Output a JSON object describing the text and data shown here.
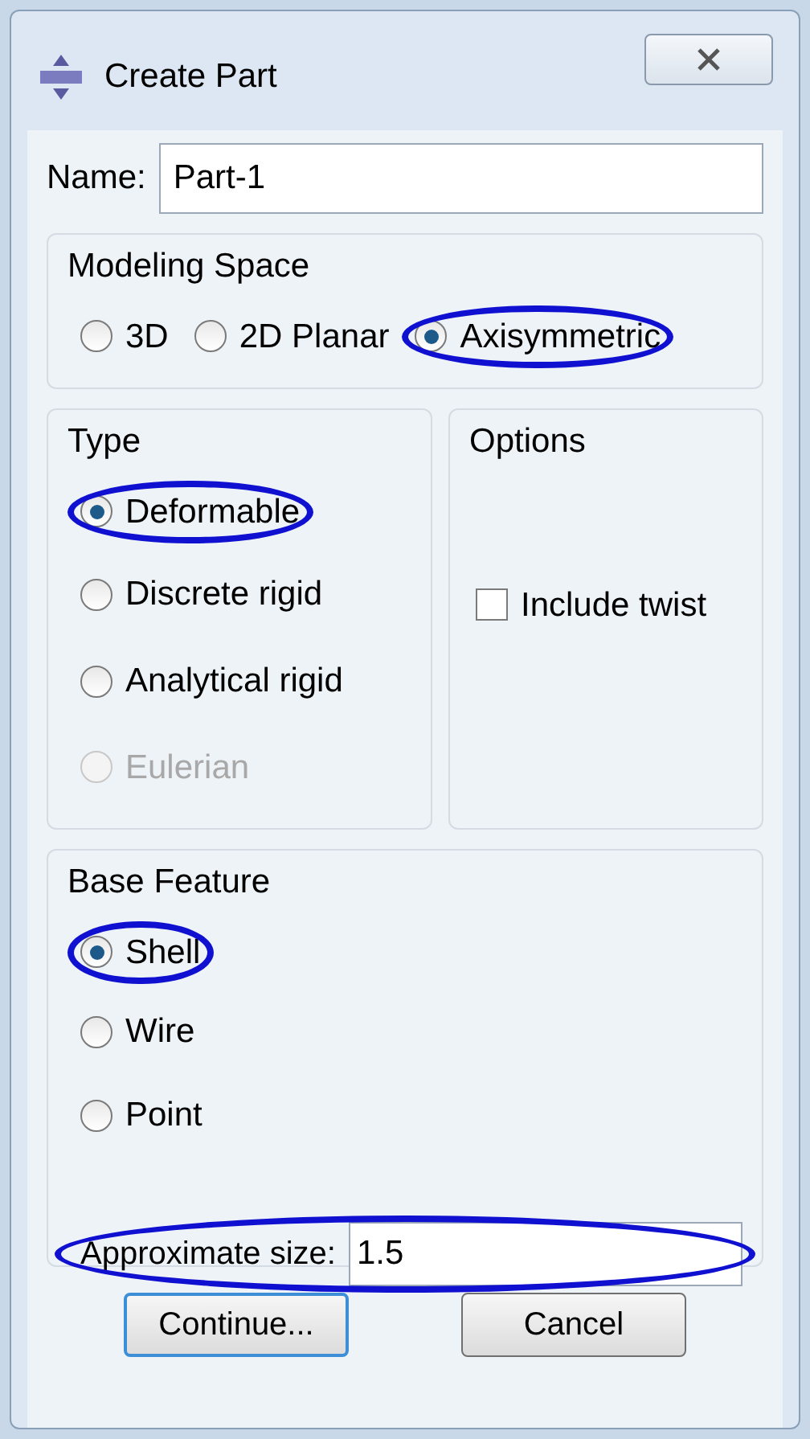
{
  "window": {
    "title": "Create Part"
  },
  "name": {
    "label": "Name:",
    "value": "Part-1"
  },
  "modeling_space": {
    "title": "Modeling Space",
    "options": [
      {
        "label": "3D",
        "selected": false,
        "circled": false
      },
      {
        "label": "2D Planar",
        "selected": false,
        "circled": false
      },
      {
        "label": "Axisymmetric",
        "selected": true,
        "circled": true
      }
    ]
  },
  "type": {
    "title": "Type",
    "options": [
      {
        "label": "Deformable",
        "selected": true,
        "disabled": false,
        "circled": true
      },
      {
        "label": "Discrete rigid",
        "selected": false,
        "disabled": false,
        "circled": false
      },
      {
        "label": "Analytical rigid",
        "selected": false,
        "disabled": false,
        "circled": false
      },
      {
        "label": "Eulerian",
        "selected": false,
        "disabled": true,
        "circled": false
      }
    ]
  },
  "options": {
    "title": "Options",
    "checkbox": {
      "label": "Include twist",
      "checked": false
    }
  },
  "base_feature": {
    "title": "Base Feature",
    "options": [
      {
        "label": "Shell",
        "selected": true,
        "circled": true
      },
      {
        "label": "Wire",
        "selected": false,
        "circled": false
      },
      {
        "label": "Point",
        "selected": false,
        "circled": false
      }
    ]
  },
  "approximate_size": {
    "label": "Approximate size:",
    "value": "1.5",
    "circled": true
  },
  "buttons": [
    {
      "label": "Continue...",
      "focused": true
    },
    {
      "label": "Cancel",
      "focused": false
    }
  ]
}
